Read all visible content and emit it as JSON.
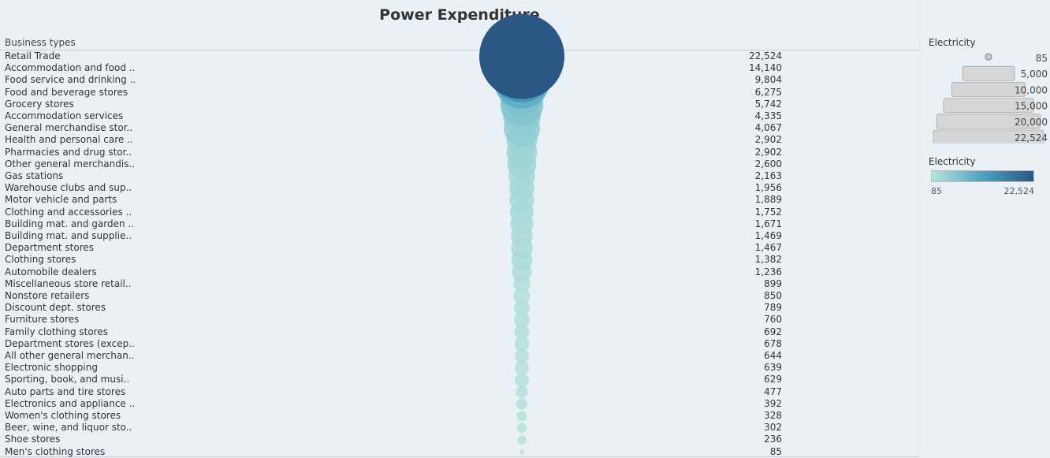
{
  "chart_data": {
    "type": "scatter",
    "title": "Power Expenditure",
    "dimension_header": "Business types",
    "size_measure": "Electricity",
    "color_measure": "Electricity",
    "categories": [
      "Retail Trade",
      "Accommodation and food ..",
      "Food service and drinking ..",
      "Food and beverage stores",
      "Grocery stores",
      "Accommodation services",
      "General merchandise stor..",
      "Health and personal care ..",
      "Pharmacies and drug stor..",
      "Other general merchandis..",
      "Gas stations",
      "Warehouse clubs and sup..",
      "Motor vehicle and parts",
      "Clothing and accessories ..",
      "Building mat. and garden ..",
      "Building mat. and supplie..",
      "Department stores",
      "Clothing stores",
      "Automobile dealers",
      "Miscellaneous store retail..",
      "Nonstore retailers",
      "Discount dept. stores",
      "Furniture stores",
      "Family clothing stores",
      "Department stores (excep..",
      "All other general merchan..",
      "Electronic shopping",
      "Sporting, book, and  musi..",
      "Auto parts and tire stores",
      "Electronics and appliance ..",
      "Women's clothing stores",
      "Beer, wine, and liquor sto..",
      "Shoe stores",
      "Men's clothing stores"
    ],
    "values": [
      22524,
      14140,
      9804,
      6275,
      5742,
      4335,
      4067,
      2902,
      2902,
      2600,
      2163,
      1956,
      1889,
      1752,
      1671,
      1469,
      1467,
      1382,
      1236,
      899,
      850,
      789,
      760,
      692,
      678,
      644,
      639,
      629,
      477,
      392,
      328,
      302,
      236,
      85
    ],
    "value_labels": [
      "22,524",
      "14,140",
      "9,804",
      "6,275",
      "5,742",
      "4,335",
      "4,067",
      "2,902",
      "2,902",
      "2,600",
      "2,163",
      "1,956",
      "1,889",
      "1,752",
      "1,671",
      "1,469",
      "1,467",
      "1,382",
      "1,236",
      "899",
      "850",
      "789",
      "760",
      "692",
      "678",
      "644",
      "639",
      "629",
      "477",
      "392",
      "328",
      "302",
      "236",
      "85"
    ],
    "size_legend": {
      "title": "Electricity",
      "values": [
        85,
        5000,
        10000,
        15000,
        20000,
        22524
      ],
      "labels": [
        "85",
        "5,000",
        "10,000",
        "15,000",
        "20,000",
        "22,524"
      ]
    },
    "color_legend": {
      "title": "Electricity",
      "min": 85,
      "max": 22524,
      "min_label": "85",
      "max_label": "22,524",
      "color_low": "#b8e3dc",
      "color_mid": "#4ba3c3",
      "color_high": "#2a5783"
    }
  }
}
